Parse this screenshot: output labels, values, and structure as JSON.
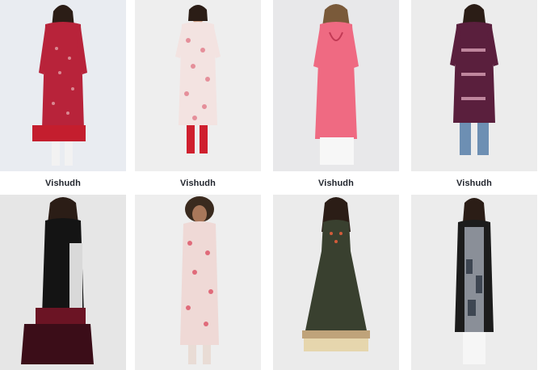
{
  "products": [
    {
      "brand": "Vishudh",
      "image": "woman in red printed kurta with red trousers",
      "color": "#b8233a"
    },
    {
      "brand": "Vishudh",
      "image": "woman in white and pink printed kurta with red leggings",
      "color": "#e58f9a"
    },
    {
      "brand": "Vishudh",
      "image": "woman in pink embroidered kurta with white palazzos",
      "color": "#ef6a82"
    },
    {
      "brand": "Vishudh",
      "image": "woman in purple printed kurta with jeans",
      "color": "#5a1f3d"
    },
    {
      "brand": "",
      "image": "woman in black colourblocked kurta with maroon skirt",
      "color": "#141414"
    },
    {
      "brand": "",
      "image": "woman in white and pink printed kurta",
      "color": "#efd9d6"
    },
    {
      "brand": "",
      "image": "woman in olive green anarkali kurta",
      "color": "#39402f"
    },
    {
      "brand": "",
      "image": "woman in black and grey printed kurta",
      "color": "#1c1c1c"
    }
  ]
}
